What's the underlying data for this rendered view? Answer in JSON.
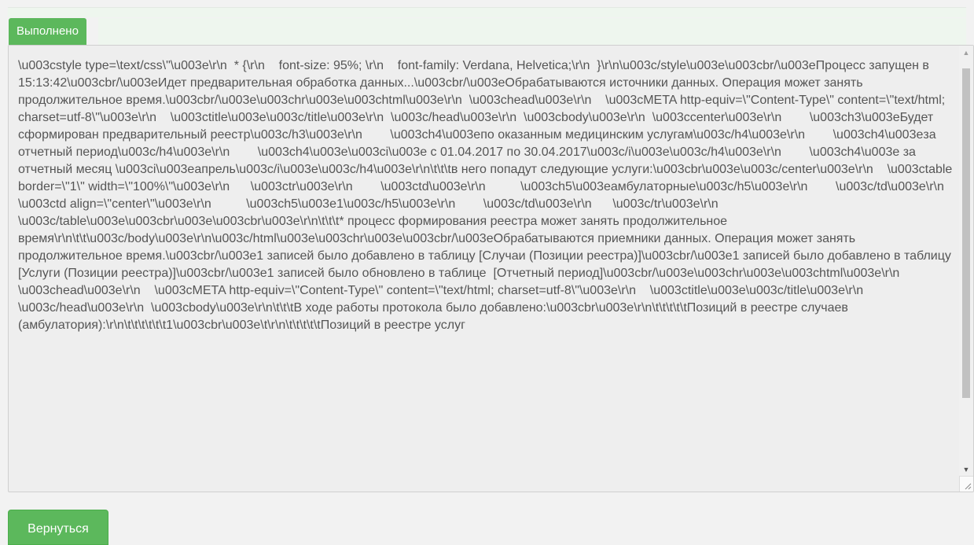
{
  "status": {
    "label": "Выполнено",
    "color": "#5cb85c"
  },
  "log": {
    "text": "\\u003cstyle type=\\text/css\\\"\\u003e\\r\\n  * {\\r\\n    font-size: 95%; \\r\\n    font-family: Verdana, Helvetica;\\r\\n  }\\r\\n\\u003c/style\\u003e\\u003cbr/\\u003eПроцесс запущен в 15:13:42\\u003cbr/\\u003eИдет предварительная обработка данных...\\u003cbr/\\u003eОбрабатываются источники данных. Операция может занять продолжительное время.\\u003cbr/\\u003e\\u003chr\\u003e\\u003chtml\\u003e\\r\\n  \\u003chead\\u003e\\r\\n    \\u003cMETA http-equiv=\\\"Content-Type\\\" content=\\\"text/html; charset=utf-8\\\"\\u003e\\r\\n    \\u003ctitle\\u003e\\u003c/title\\u003e\\r\\n  \\u003c/head\\u003e\\r\\n  \\u003cbody\\u003e\\r\\n  \\u003ccenter\\u003e\\r\\n        \\u003ch3\\u003eБудет сформирован предварительный реестр\\u003c/h3\\u003e\\r\\n        \\u003ch4\\u003eпо оказанным медицинским услугам\\u003c/h4\\u003e\\r\\n        \\u003ch4\\u003eза отчетный период\\u003c/h4\\u003e\\r\\n        \\u003ch4\\u003e\\u003ci\\u003e с 01.04.2017 по 30.04.2017\\u003c/i\\u003e\\u003c/h4\\u003e\\r\\n        \\u003ch4\\u003e за отчетный месяц \\u003ci\\u003eапрель\\u003c/i\\u003e\\u003c/h4\\u003e\\r\\n\\t\\t\\tв него попадут следующие услуги:\\u003cbr\\u003e\\u003c/center\\u003e\\r\\n    \\u003ctable border=\\\"1\\\" width=\\\"100%\\\"\\u003e\\r\\n      \\u003ctr\\u003e\\r\\n        \\u003ctd\\u003e\\r\\n          \\u003ch5\\u003eамбулаторные\\u003c/h5\\u003e\\r\\n        \\u003c/td\\u003e\\r\\n        \\u003ctd align=\\\"center\\\"\\u003e\\r\\n          \\u003ch5\\u003e1\\u003c/h5\\u003e\\r\\n        \\u003c/td\\u003e\\r\\n      \\u003c/tr\\u003e\\r\\n    \\u003c/table\\u003e\\u003cbr\\u003e\\u003cbr\\u003e\\r\\n\\t\\t\\t* процесс формирования реестра может занять продолжительное время\\r\\n\\t\\t\\u003c/body\\u003e\\r\\n\\u003c/html\\u003e\\u003chr\\u003e\\u003cbr/\\u003eОбрабатываются приемники данных. Операция может занять продолжительное время.\\u003cbr/\\u003e1 записей было добавлено в таблицу [Случаи (Позиции реестра)]\\u003cbr/\\u003e1 записей было добавлено в таблицу [Услуги (Позиции реестра)]\\u003cbr/\\u003e1 записей было обновлено в таблице  [Отчетный период]\\u003cbr/\\u003e\\u003chr\\u003e\\u003chtml\\u003e\\r\\n  \\u003chead\\u003e\\r\\n    \\u003cMETA http-equiv=\\\"Content-Type\\\" content=\\\"text/html; charset=utf-8\\\"\\u003e\\r\\n    \\u003ctitle\\u003e\\u003c/title\\u003e\\r\\n  \\u003c/head\\u003e\\r\\n  \\u003cbody\\u003e\\r\\n\\t\\t\\tВ ходе работы протокола было добавлено:\\u003cbr\\u003e\\r\\n\\t\\t\\t\\t\\tПозиций в реестре случаев (амбулатория):\\r\\n\\t\\t\\t\\t\\t\\t1\\u003cbr\\u003e\\t\\r\\n\\t\\t\\t\\t\\tПозиций в реестре услуг"
  },
  "footer": {
    "back_label": "Вернуться"
  },
  "icons": {
    "scroll_up": "scroll-up-arrow-icon",
    "scroll_down": "scroll-down-arrow-icon",
    "resize": "resize-grip-icon"
  }
}
